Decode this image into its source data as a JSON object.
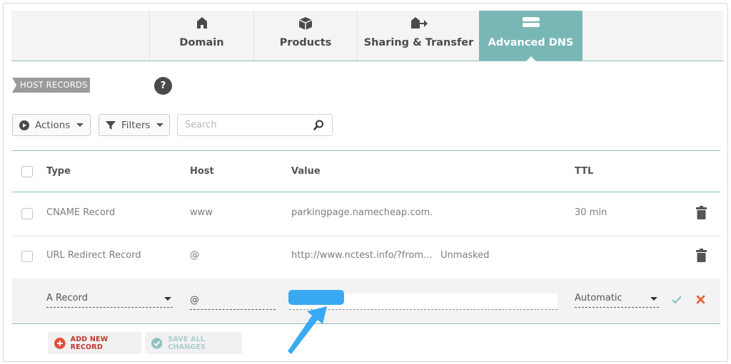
{
  "tabs": [
    {
      "label": "Domain",
      "icon": "house-icon"
    },
    {
      "label": "Products",
      "icon": "box-icon"
    },
    {
      "label": "Sharing & Transfer",
      "icon": "transfer-icon"
    },
    {
      "label": "Advanced DNS",
      "icon": "server-icon",
      "active": true
    }
  ],
  "section": {
    "tag": "HOST RECORDS",
    "help": "?"
  },
  "toolbar": {
    "actions_label": "Actions",
    "filters_label": "Filters",
    "search_placeholder": "Search"
  },
  "table": {
    "headers": {
      "type": "Type",
      "host": "Host",
      "value": "Value",
      "ttl": "TTL"
    },
    "rows": [
      {
        "type": "CNAME Record",
        "host": "www",
        "value": "parkingpage.namecheap.com.",
        "extra": "",
        "ttl": "30 min"
      },
      {
        "type": "URL Redirect Record",
        "host": "@",
        "value": "http://www.nctest.info/?from...",
        "extra": "Unmasked",
        "ttl": ""
      }
    ],
    "edit_row": {
      "type": "A Record",
      "host": "@",
      "value": "",
      "ttl": "Automatic"
    }
  },
  "actions": {
    "add_label": "ADD NEW RECORD",
    "save_label": "SAVE ALL CHANGES"
  },
  "colors": {
    "accent": "#79b7b6",
    "highlight": "#3aa9f4",
    "danger": "#e8572f",
    "confirm": "#7dbdbb"
  }
}
